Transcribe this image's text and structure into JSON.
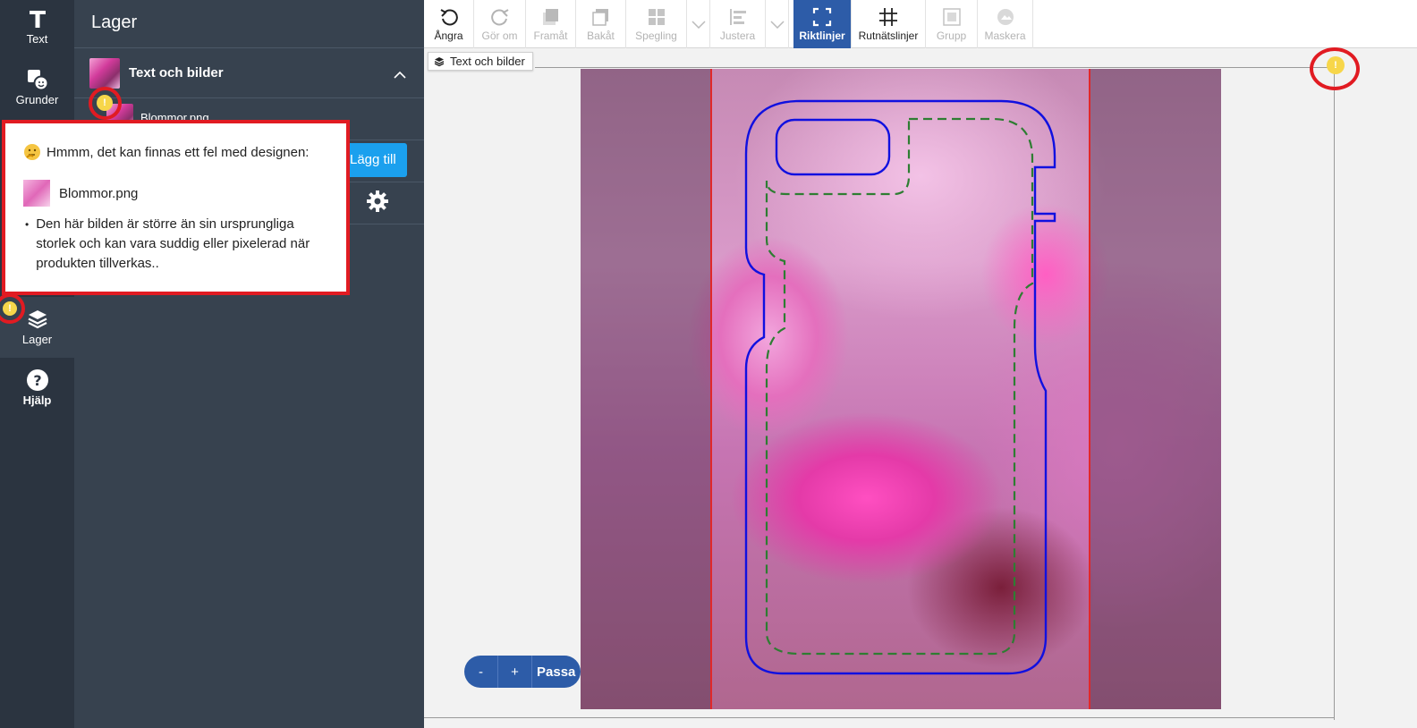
{
  "rail": {
    "items": [
      {
        "label": "Text",
        "icon": "text-icon"
      },
      {
        "label": "Grunder",
        "icon": "shapes-icon"
      },
      {
        "label": "Lager",
        "icon": "layers-icon"
      },
      {
        "label": "Hjälp",
        "icon": "help-icon"
      }
    ]
  },
  "panel": {
    "title": "Lager",
    "group_label": "Text och bilder",
    "item_label": "Blommor.png",
    "add_label": "Lägg till"
  },
  "toolbar": {
    "tools": [
      {
        "label": "Ångra",
        "icon": "undo-icon",
        "state": "enabled"
      },
      {
        "label": "Gör om",
        "icon": "redo-icon",
        "state": "disabled"
      },
      {
        "label": "Framåt",
        "icon": "bring-forward-icon",
        "state": "disabled"
      },
      {
        "label": "Bakåt",
        "icon": "send-backward-icon",
        "state": "disabled"
      },
      {
        "label": "Spegling",
        "icon": "mirror-icon",
        "state": "disabled"
      },
      {
        "label": "Justera",
        "icon": "align-icon",
        "state": "disabled"
      },
      {
        "label": "Riktlinjer",
        "icon": "guidelines-icon",
        "state": "active"
      },
      {
        "label": "Rutnätslinjer",
        "icon": "grid-icon",
        "state": "enabled"
      },
      {
        "label": "Grupp",
        "icon": "group-icon",
        "state": "disabled"
      },
      {
        "label": "Maskera",
        "icon": "mask-icon",
        "state": "disabled"
      }
    ]
  },
  "canvas": {
    "layer_chip": "Text och bilder"
  },
  "zoom": {
    "minus": "-",
    "plus": "+",
    "fit": "Passa"
  },
  "popup": {
    "heading": "Hmmm, det kan finnas ett fel med designen:",
    "file": "Blommor.png",
    "message": "Den här bilden är större än sin ursprungliga storlek och kan vara suddig eller pixelerad när produkten tillverkas.."
  },
  "colors": {
    "rail_bg": "#2b3440",
    "panel_bg": "#37424f",
    "accent_blue": "#2d5ca8",
    "add_button": "#1ba0ee",
    "warning_red": "#e11b22",
    "warning_yellow": "#f7d64a",
    "case_outline": "#1010e0",
    "safe_zone_dashed": "#2e7d32"
  }
}
